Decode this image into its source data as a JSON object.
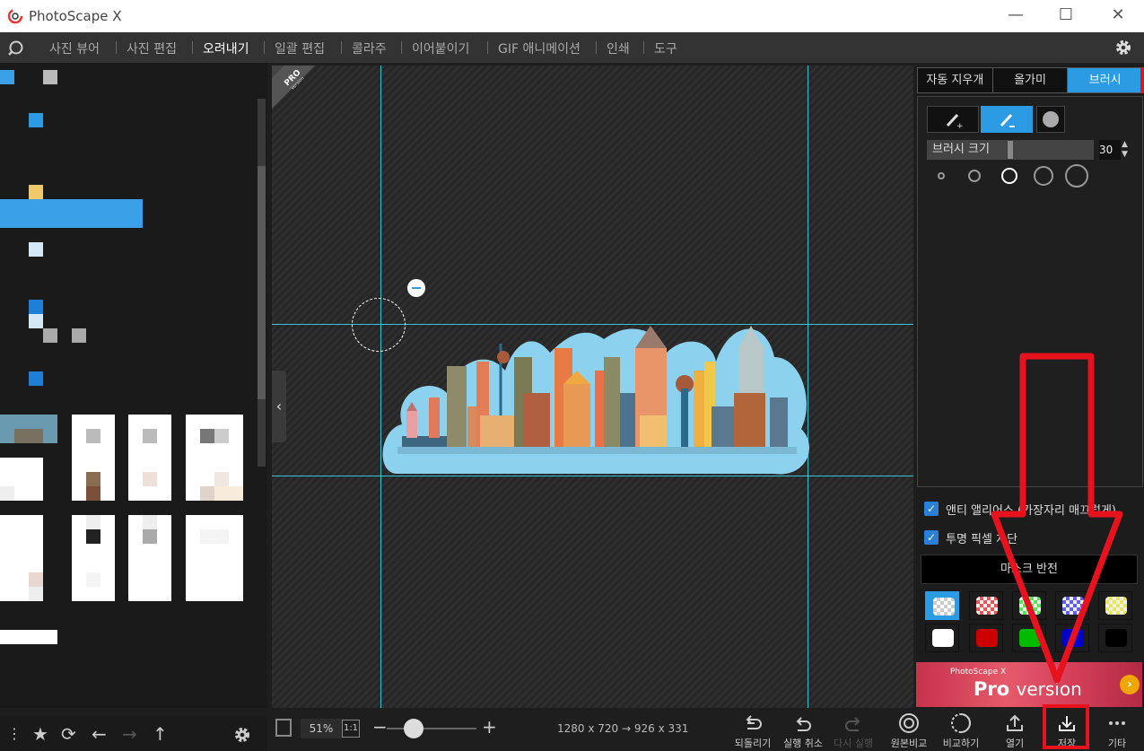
{
  "titlebar": {
    "title": "PhotoScape X",
    "minimize": "—",
    "maximize": "☐",
    "close": "✕"
  },
  "menu": {
    "items": [
      "사진 뷰어",
      "사진 편집",
      "오려내기",
      "일괄 편집",
      "콜라주",
      "이어붙이기",
      "GIF 애니메이션",
      "인쇄",
      "도구"
    ],
    "active": "오려내기"
  },
  "canvas": {
    "pro_ribbon": "PRO",
    "pro_ribbon_sub": "Version",
    "collapse_glyph": "‹"
  },
  "right": {
    "tabs": [
      "자동 지우개",
      "올가미",
      "브러시"
    ],
    "active_tab": "브러시",
    "brush_size_label": "브러시 크기",
    "brush_size_value": "30",
    "brush_size_level": 0.5,
    "spin_up": "▲",
    "spin_down": "▼",
    "antialias_label": "앤티 앨리어스 (가장자리 매끄럽게)",
    "block_transparent_label": "투명 픽셀 차단",
    "check_mark": "✓",
    "mask_invert": "마스크 반전",
    "swatches": [
      "#e85555",
      "#55e855",
      "#6060f0",
      "#e8e855",
      "#ffffff",
      "#cc0000",
      "#00bb00",
      "#0000cc",
      "#000000"
    ],
    "banner_brand": "PhotoScape X",
    "banner_pro": "Pro",
    "banner_version": "version",
    "banner_arrow": "›"
  },
  "bottom": {
    "zoom": "51%",
    "one_to_one": "1:1",
    "minus": "−",
    "plus": "+",
    "zoom_level": 0.2,
    "dimensions": "1280 x 720 → 926 x 331",
    "actions": [
      "되돌리기",
      "실행 취소",
      "다시 실행",
      "원본비교",
      "비교하기",
      "열기",
      "저장",
      "기타"
    ]
  },
  "left_bottom": {
    "star": "★",
    "refresh": "⟳",
    "back": "←",
    "forward": "→",
    "up": "↑"
  }
}
